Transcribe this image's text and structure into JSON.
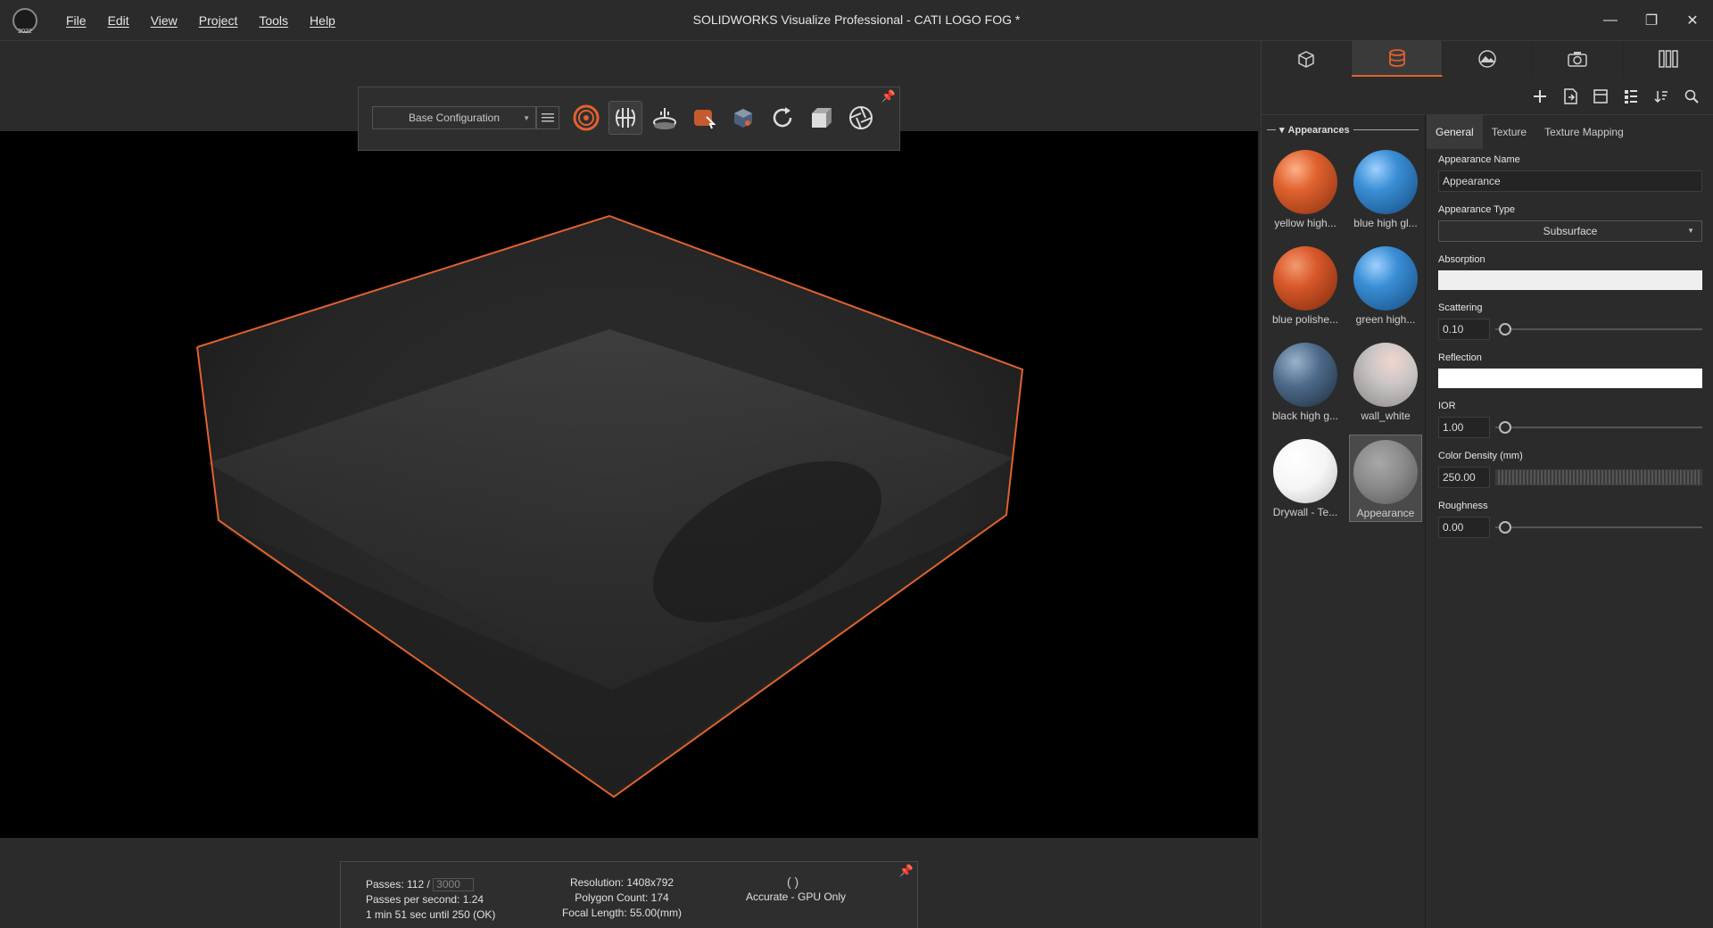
{
  "titlebar": {
    "title": "SOLIDWORKS Visualize Professional - CATI LOGO FOG *",
    "logo_year": "2022",
    "menu": [
      "File",
      "Edit",
      "View",
      "Project",
      "Tools",
      "Help"
    ],
    "controls": {
      "minimize": "—",
      "restore": "❐",
      "close": "✕"
    }
  },
  "toolbar": {
    "configuration": "Base Configuration",
    "icons": [
      "appearances-icon",
      "model-icon",
      "turntable-icon",
      "appearance-pick-icon",
      "scene-icon",
      "refresh-icon",
      "camera-icon",
      "render-icon"
    ]
  },
  "status": {
    "passes_label": "Passes: 112 /",
    "passes_target": "3000",
    "passes_per_second": "Passes per second: 1.24",
    "time_remaining": "1 min 51 sec until 250 (OK)",
    "resolution": "Resolution: 1408x792",
    "polygon_count": "Polygon Count: 174",
    "focal_length": "Focal Length: 55.00(mm)",
    "render_mode": "Accurate - GPU Only"
  },
  "panel": {
    "tabs": [
      "models-tab",
      "appearances-tab",
      "scenes-tab",
      "cameras-tab",
      "libraries-tab"
    ],
    "library_title": "Appearances",
    "appearances": [
      {
        "label": "yellow high...",
        "color": "#e0622e"
      },
      {
        "label": "blue high gl...",
        "color": "#3a8fd6"
      },
      {
        "label": "blue polishe...",
        "color": "#d9582a"
      },
      {
        "label": "green high...",
        "color": "#3a8fd6"
      },
      {
        "label": "black high g...",
        "color": "#4d6a8a"
      },
      {
        "label": "wall_white",
        "color": "#c9c4c4"
      },
      {
        "label": "Drywall - Te...",
        "color": "#f5f5f5"
      },
      {
        "label": "Appearance",
        "color": "#8a8a8a"
      }
    ],
    "prop_tabs": [
      "General",
      "Texture",
      "Texture Mapping"
    ],
    "props": {
      "name_label": "Appearance Name",
      "name_value": "Appearance",
      "type_label": "Appearance Type",
      "type_value": "Subsurface",
      "absorption_label": "Absorption",
      "scattering_label": "Scattering",
      "scattering_value": "0.10",
      "reflection_label": "Reflection",
      "ior_label": "IOR",
      "ior_value": "1.00",
      "density_label": "Color Density (mm)",
      "density_value": "250.00",
      "roughness_label": "Roughness",
      "roughness_value": "0.00"
    }
  }
}
